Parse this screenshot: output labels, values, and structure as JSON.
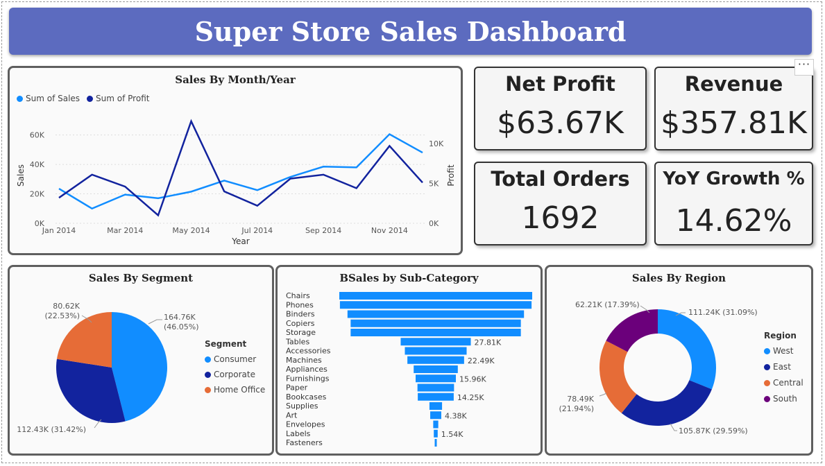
{
  "dashboard": {
    "title": "Super Store Sales Dashboard"
  },
  "kpis": {
    "net_profit": {
      "label": "Net Profit",
      "value": "$63.67K"
    },
    "revenue": {
      "label": "Revenue",
      "value": "$357.81K"
    },
    "total_orders": {
      "label": "Total Orders",
      "value": "1692"
    },
    "yoy_growth": {
      "label": "YoY Growth %",
      "value": "14.62%"
    }
  },
  "more_options": {
    "label": "···"
  },
  "colors": {
    "sales": "#118dff",
    "profit": "#12239e",
    "consumer": "#118dff",
    "corporate": "#12239e",
    "home_office": "#e66c37",
    "west": "#118dff",
    "east": "#12239e",
    "central": "#e66c37",
    "south": "#6b007b",
    "banner": "#5c6bbf"
  },
  "chart_data": [
    {
      "type": "line",
      "title": "Sales By Month/Year",
      "xlabel": "Year",
      "ylabel": "Sales",
      "y2label": "Profit",
      "legend": [
        "Sum of Sales",
        "Sum of Profit"
      ],
      "legend_position": "top-left",
      "x": [
        "Jan 2014",
        "Feb 2014",
        "Mar 2014",
        "Apr 2014",
        "May 2014",
        "Jun 2014",
        "Jul 2014",
        "Aug 2014",
        "Sep 2014",
        "Oct 2014",
        "Nov 2014",
        "Dec 2014"
      ],
      "x_tick_labels": [
        "Jan 2014",
        "Mar 2014",
        "May 2014",
        "Jul 2014",
        "Sep 2014",
        "Nov 2014"
      ],
      "y_ticks": [
        "0K",
        "20K",
        "40K",
        "60K"
      ],
      "y2_ticks": [
        "0K",
        "5K",
        "10K"
      ],
      "ylim": [
        0,
        65000
      ],
      "y2lim": [
        0,
        12000
      ],
      "grid": true,
      "series": [
        {
          "name": "Sum of Sales",
          "axis": "left",
          "values": [
            23500,
            10000,
            19500,
            17000,
            21500,
            29000,
            22500,
            31500,
            38500,
            38000,
            60500,
            48000
          ]
        },
        {
          "name": "Sum of Profit",
          "axis": "right",
          "values": [
            3200,
            6100,
            4600,
            1000,
            12800,
            4000,
            2200,
            5600,
            6100,
            4400,
            9700,
            5100
          ]
        }
      ]
    },
    {
      "type": "pie",
      "title": "Sales By Segment",
      "legend_title": "Segment",
      "legend_position": "right",
      "slices": [
        {
          "name": "Consumer",
          "value": 164.76,
          "label": "164.76K",
          "pct": "(46.05%)"
        },
        {
          "name": "Corporate",
          "value": 112.43,
          "label": "112.43K (31.42%)",
          "pct": ""
        },
        {
          "name": "Home Office",
          "value": 80.62,
          "label": "80.62K",
          "pct": "(22.53%)"
        }
      ]
    },
    {
      "type": "bar",
      "title": "BSales by Sub-Category",
      "categories": [
        "Chairs",
        "Phones",
        "Binders",
        "Copiers",
        "Storage",
        "Tables",
        "Accessories",
        "Machines",
        "Appliances",
        "Furnishings",
        "Paper",
        "Bookcases",
        "Supplies",
        "Art",
        "Envelopes",
        "Labels",
        "Fasteners"
      ],
      "values": [
        76.5,
        76.0,
        70.0,
        67.5,
        67.5,
        27.81,
        24.5,
        22.49,
        17.5,
        15.96,
        14.5,
        14.25,
        5.0,
        4.38,
        2.0,
        1.54,
        0.3
      ],
      "data_labels": {
        "Tables": "27.81K",
        "Machines": "22.49K",
        "Furnishings": "15.96K",
        "Bookcases": "14.25K",
        "Art": "4.38K",
        "Labels": "1.54K"
      }
    },
    {
      "type": "pie",
      "subtype": "donut",
      "title": "Sales By Region",
      "legend_title": "Region",
      "legend_position": "right",
      "slices": [
        {
          "name": "West",
          "value": 111.24,
          "label": "111.24K (31.09%)",
          "pct": ""
        },
        {
          "name": "East",
          "value": 105.87,
          "label": "105.87K (29.59%)",
          "pct": ""
        },
        {
          "name": "Central",
          "value": 78.49,
          "label": "78.49K",
          "pct": "(21.94%)"
        },
        {
          "name": "South",
          "value": 62.21,
          "label": "62.21K (17.39%)",
          "pct": ""
        }
      ]
    }
  ]
}
